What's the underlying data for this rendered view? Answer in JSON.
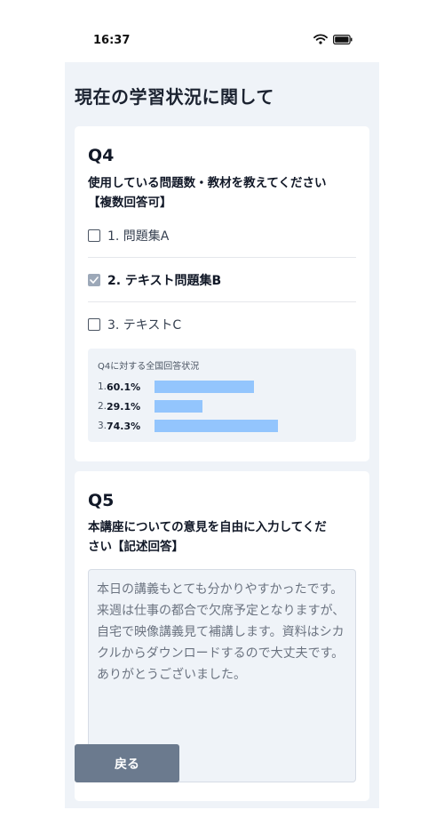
{
  "status_bar": {
    "time": "16:37",
    "icons": [
      "wifi-icon",
      "battery-icon"
    ]
  },
  "page": {
    "title": "現在の学習状況に関して"
  },
  "q4": {
    "label": "Q4",
    "question_line1": "使用している問題数・教材を教えてください",
    "question_line2": "【複数回答可】",
    "options": [
      {
        "label": "1. 問題集A",
        "checked": false
      },
      {
        "label": "2. テキスト問題集B",
        "checked": true
      },
      {
        "label": "3. テキストC",
        "checked": false
      }
    ],
    "stats": {
      "title": "Q4に対する全国回答状況",
      "rows": [
        {
          "index": "1.",
          "percent_label": "60.1%",
          "value": 60.1
        },
        {
          "index": "2.",
          "percent_label": "29.1%",
          "value": 29.1
        },
        {
          "index": "3.",
          "percent_label": "74.3%",
          "value": 74.3
        }
      ]
    }
  },
  "q5": {
    "label": "Q5",
    "question_line1": "本講座についての意見を自由に入力してくだ",
    "question_line2": "さい【記述回答】",
    "answer": "本日の講義もとても分かりやすかったです。来週は仕事の都合で欠席予定となりますが、自宅で映像講義見て補講します。資料はシカクルからダウンロードするので大丈夫です。ありがとうございました。"
  },
  "footer": {
    "back_label": "戻る"
  },
  "colors": {
    "screen_bg": "#eff3f8",
    "bar": "#93c5fd",
    "back_button": "#6b7a8e"
  }
}
